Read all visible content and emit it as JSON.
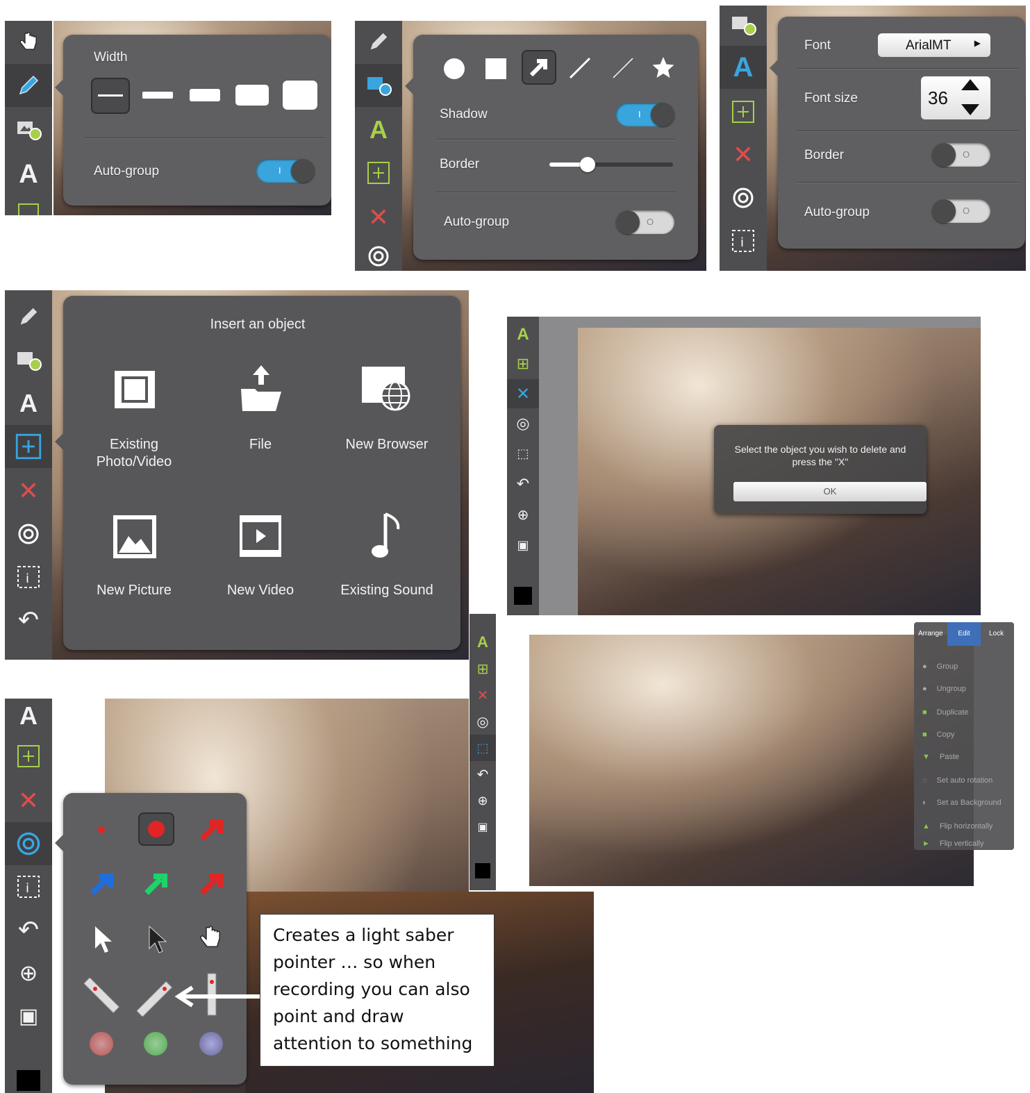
{
  "width_panel": {
    "title": "Width",
    "auto_group_label": "Auto-group",
    "auto_group_on": true,
    "switch_on_mark": "I"
  },
  "shape_panel": {
    "shadow_label": "Shadow",
    "shadow_on": true,
    "border_label": "Border",
    "border_level": 0.28,
    "auto_group_label": "Auto-group",
    "auto_group_on": false,
    "switch_on_mark": "I",
    "switch_off_mark": "O",
    "shapes": [
      "circle-icon",
      "square-icon",
      "arrow-icon",
      "thick-line-icon",
      "thin-line-icon",
      "star-icon"
    ],
    "selected_shape": "arrow-icon"
  },
  "text_panel": {
    "font_label": "Font",
    "font_value": "ArialMT",
    "font_size_label": "Font size",
    "font_size_value": "36",
    "border_label": "Border",
    "border_on": false,
    "auto_group_label": "Auto-group",
    "auto_group_on": false,
    "switch_off_mark": "O"
  },
  "insert_panel": {
    "title": "Insert an object",
    "items": [
      {
        "label": "Existing\nPhoto/Video",
        "icon": "film-strip-icon"
      },
      {
        "label": "File",
        "icon": "folder-upload-icon"
      },
      {
        "label": "New Browser",
        "icon": "globe-browser-icon"
      },
      {
        "label": "New Picture",
        "icon": "picture-icon"
      },
      {
        "label": "New Video",
        "icon": "video-play-icon"
      },
      {
        "label": "Existing Sound",
        "icon": "music-note-icon"
      }
    ]
  },
  "delete_dialog": {
    "message": "Select the object you wish to delete and press the \"X\"",
    "ok_label": "OK"
  },
  "edit_menu": {
    "tabs": [
      "Arrange",
      "Edit",
      "Lock"
    ],
    "active_tab": "Edit",
    "items": [
      "Group",
      "Ungroup",
      "Duplicate",
      "Copy",
      "Paste",
      "Set auto rotation",
      "Set as Background",
      "Flip horizontally",
      "Flip vertically"
    ]
  },
  "pointer_panel": {
    "callout_text": "Creates a light saber pointer … so when recording you can also point and draw attention to something",
    "colors": {
      "red": "#e22424",
      "blue": "#1e6ee0",
      "green": "#1ed46a"
    }
  },
  "toolbar_icons": [
    "hand-icon",
    "pencil-icon",
    "shape-icon",
    "text-icon",
    "insert-icon",
    "delete-icon",
    "pointer-icon",
    "info-select-icon",
    "undo-icon",
    "zoom-icon",
    "background-icon",
    "color-swatch"
  ]
}
